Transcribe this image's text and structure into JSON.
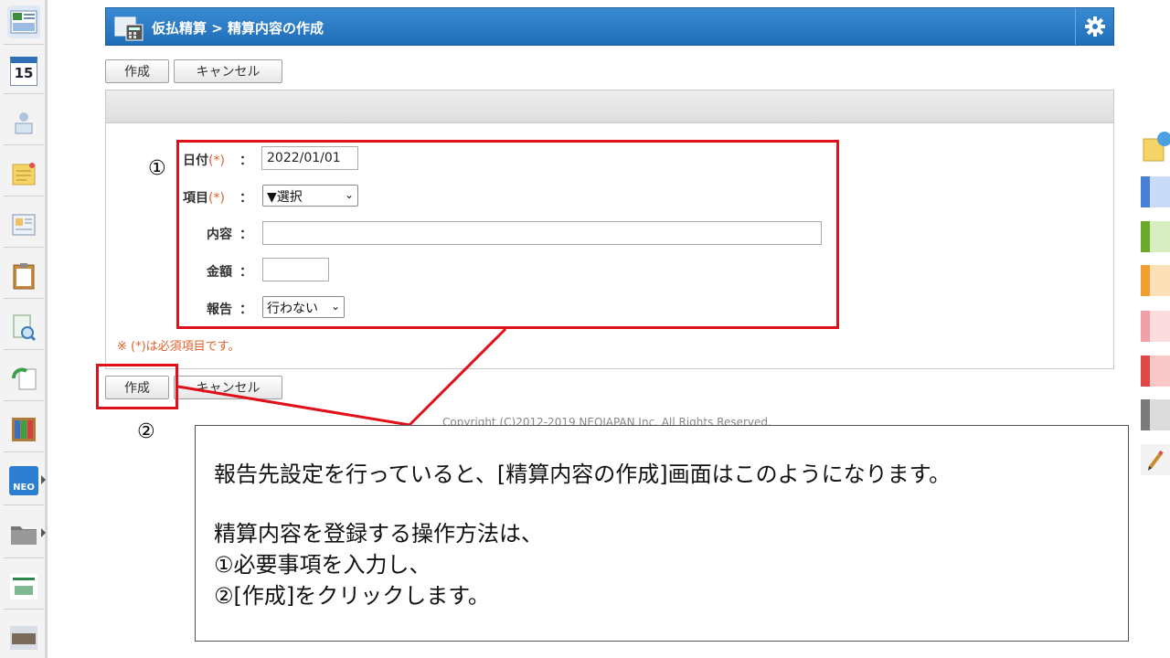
{
  "header": {
    "title": "仮払精算 > 精算内容の作成"
  },
  "toolbar_top": {
    "create_label": "作成",
    "cancel_label": "キャンセル"
  },
  "toolbar_bottom": {
    "create_label": "作成",
    "cancel_label": "キャンセル"
  },
  "sidebar": {
    "calendar_day": "15",
    "neo_label": "NEO"
  },
  "form": {
    "date": {
      "label": "日付",
      "required": "(*)",
      "colon": "：",
      "value": "2022/01/01"
    },
    "item": {
      "label": "項目",
      "required": "(*)",
      "colon": "：",
      "selected": "▼選択"
    },
    "content": {
      "label": "内容",
      "colon": "：",
      "value": ""
    },
    "amount": {
      "label": "金額",
      "colon": "：",
      "value": ""
    },
    "report": {
      "label": "報告",
      "colon": "：",
      "selected": "行わない"
    },
    "required_note": "※ (*)は必須項目です。"
  },
  "annotations": {
    "mark1": "①",
    "mark2": "②"
  },
  "copyright": "Copyright (C)2012-2019 NEOJAPAN Inc. All Rights Reserved.",
  "callout": {
    "line1": "報告先設定を行っていると、[精算内容の作成]画面はこのようになります。",
    "line2": "精算内容を登録する操作方法は、",
    "line3": "①必要事項を入力し、",
    "line4": "②[作成]をクリックします。"
  },
  "colors": {
    "header_blue": "#2a7cc7",
    "annotation_red": "#e0101a",
    "required_orange": "#e0622d"
  }
}
